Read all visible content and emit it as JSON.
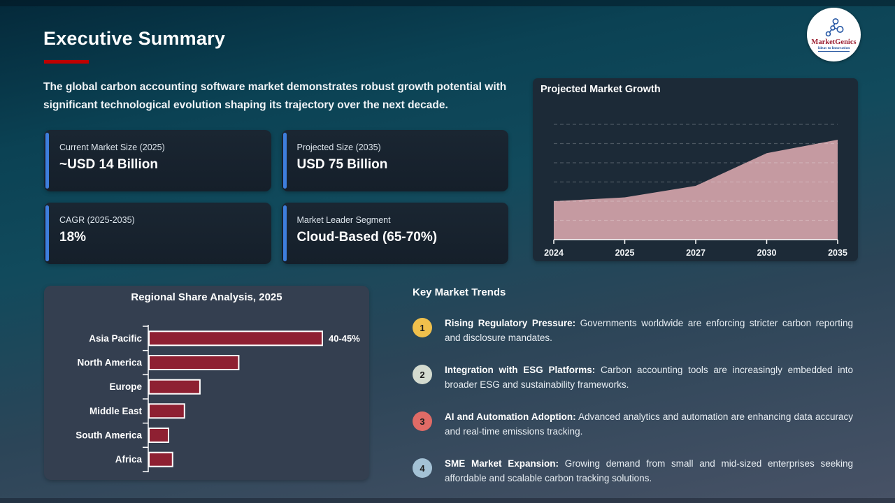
{
  "header": {
    "title": "Executive Summary",
    "intro": "The global carbon accounting software market demonstrates robust growth potential with significant technological evolution shaping its trajectory over the next decade.",
    "logo": {
      "brand": "MarketGenics",
      "tagline": "Ideas to Innovation"
    }
  },
  "stats": [
    {
      "label": "Current Market Size (2025)",
      "value": "~USD 14 Billion"
    },
    {
      "label": "Projected Size (2035)",
      "value": "USD 75 Billion"
    },
    {
      "label": "CAGR (2025-2035)",
      "value": "18%"
    },
    {
      "label": "Market Leader Segment",
      "value": "Cloud-Based (65-70%)"
    }
  ],
  "chart_data": [
    {
      "type": "area",
      "title": "Projected Market Growth",
      "x": [
        "2024",
        "2025",
        "2027",
        "2030",
        "2035"
      ],
      "values": [
        20,
        22,
        28,
        45,
        52
      ],
      "ylim": [
        0,
        60
      ],
      "grid": true,
      "grid_step": 10,
      "legend": "none",
      "area_color": "#c59aa1",
      "note": "y-values estimated from gridlines; no y tick labels shown"
    },
    {
      "type": "bar",
      "orientation": "horizontal",
      "title": "Regional Share Analysis, 2025",
      "categories": [
        "Asia Pacific",
        "North America",
        "Europe",
        "Middle East",
        "South America",
        "Africa"
      ],
      "values": [
        42.5,
        22,
        12.5,
        8.7,
        4.8,
        5.8
      ],
      "value_labels": [
        "40-45%",
        "",
        "",
        "",
        "",
        ""
      ],
      "xlim": [
        0,
        50
      ],
      "grid": false,
      "legend": "none",
      "bar_color": "#8e2032",
      "bar_border": "#ffffff",
      "note": "only the Asia Pacific bar is labeled; other values estimated from bar lengths"
    }
  ],
  "trends": {
    "heading": "Key Market Trends",
    "items": [
      {
        "num": "1",
        "badge_color": "#f0c04c",
        "lead": "Rising Regulatory Pressure:",
        "text": "Governments worldwide are enforcing stricter carbon reporting and disclosure mandates."
      },
      {
        "num": "2",
        "badge_color": "#d4dbd0",
        "lead": "Integration with ESG Platforms:",
        "text": "Carbon accounting tools are increasingly embedded into broader ESG and sustainability frameworks."
      },
      {
        "num": "3",
        "badge_color": "#e06b66",
        "lead": "AI and Automation Adoption:",
        "text": "Advanced analytics and automation are enhancing data accuracy and real-time emissions tracking."
      },
      {
        "num": "4",
        "badge_color": "#a4c2d6",
        "lead": "SME Market Expansion:",
        "text": "Growing demand from small and mid-sized enterprises seeking affordable and scalable carbon tracking solutions."
      }
    ]
  },
  "colors": {
    "title_underline": "#bf0000",
    "stat_accent": "#3e7edd",
    "axis": "#ffffff",
    "gridline": "rgba(255,255,255,0.22)",
    "tick_label": "#f2f5f7"
  }
}
